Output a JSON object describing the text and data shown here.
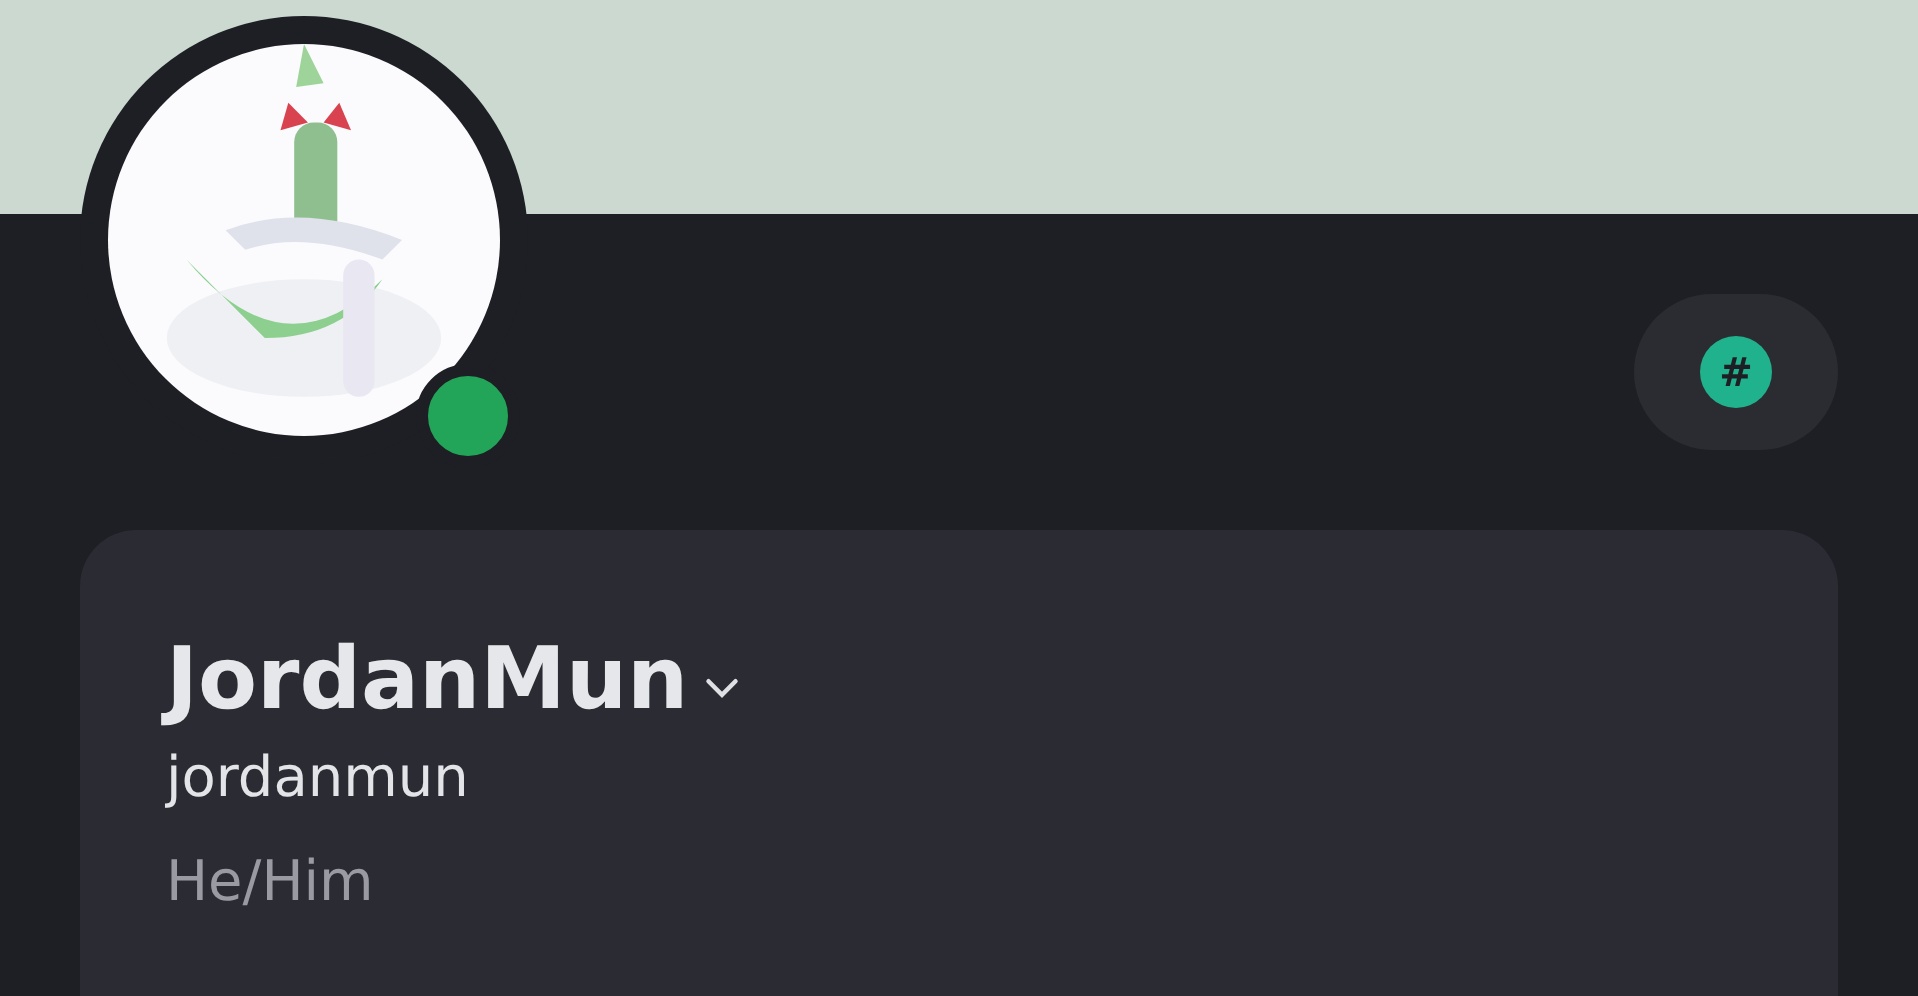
{
  "profile": {
    "avatar": {
      "online": true
    },
    "badge": {
      "symbol": "#"
    },
    "display_name": "JordanMun",
    "username": "jordanmun",
    "pronouns": "He/Him"
  }
}
